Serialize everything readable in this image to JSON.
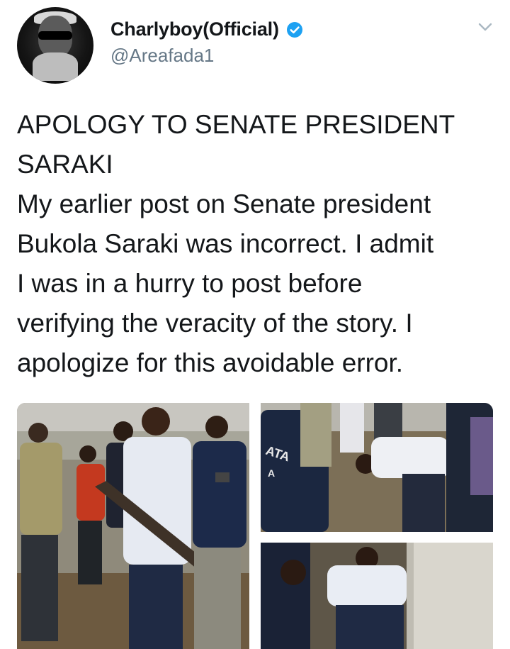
{
  "profile": {
    "display_name": "Charlyboy(Official)",
    "handle": "@Areafada1",
    "avatar_icon": "avatar-photo",
    "verified_icon": "verified-badge-icon",
    "verified_color": "#1da1f2"
  },
  "menu": {
    "icon": "chevron-down-icon"
  },
  "tweet": {
    "lines": [
      "APOLOGY TO SENATE PRESIDENT",
      "SARAKI",
      "My earlier post on Senate president",
      "Bukola Saraki was incorrect. I admit",
      "I was in a hurry to post before",
      "verifying the veracity of the story. I",
      "apologize for this avoidable error."
    ]
  },
  "media": {
    "count": 3,
    "photo_2_shirt_text": [
      "ATA",
      "A"
    ]
  },
  "colors": {
    "text": "#14171a",
    "secondary": "#657786",
    "accent": "#1da1f2"
  }
}
